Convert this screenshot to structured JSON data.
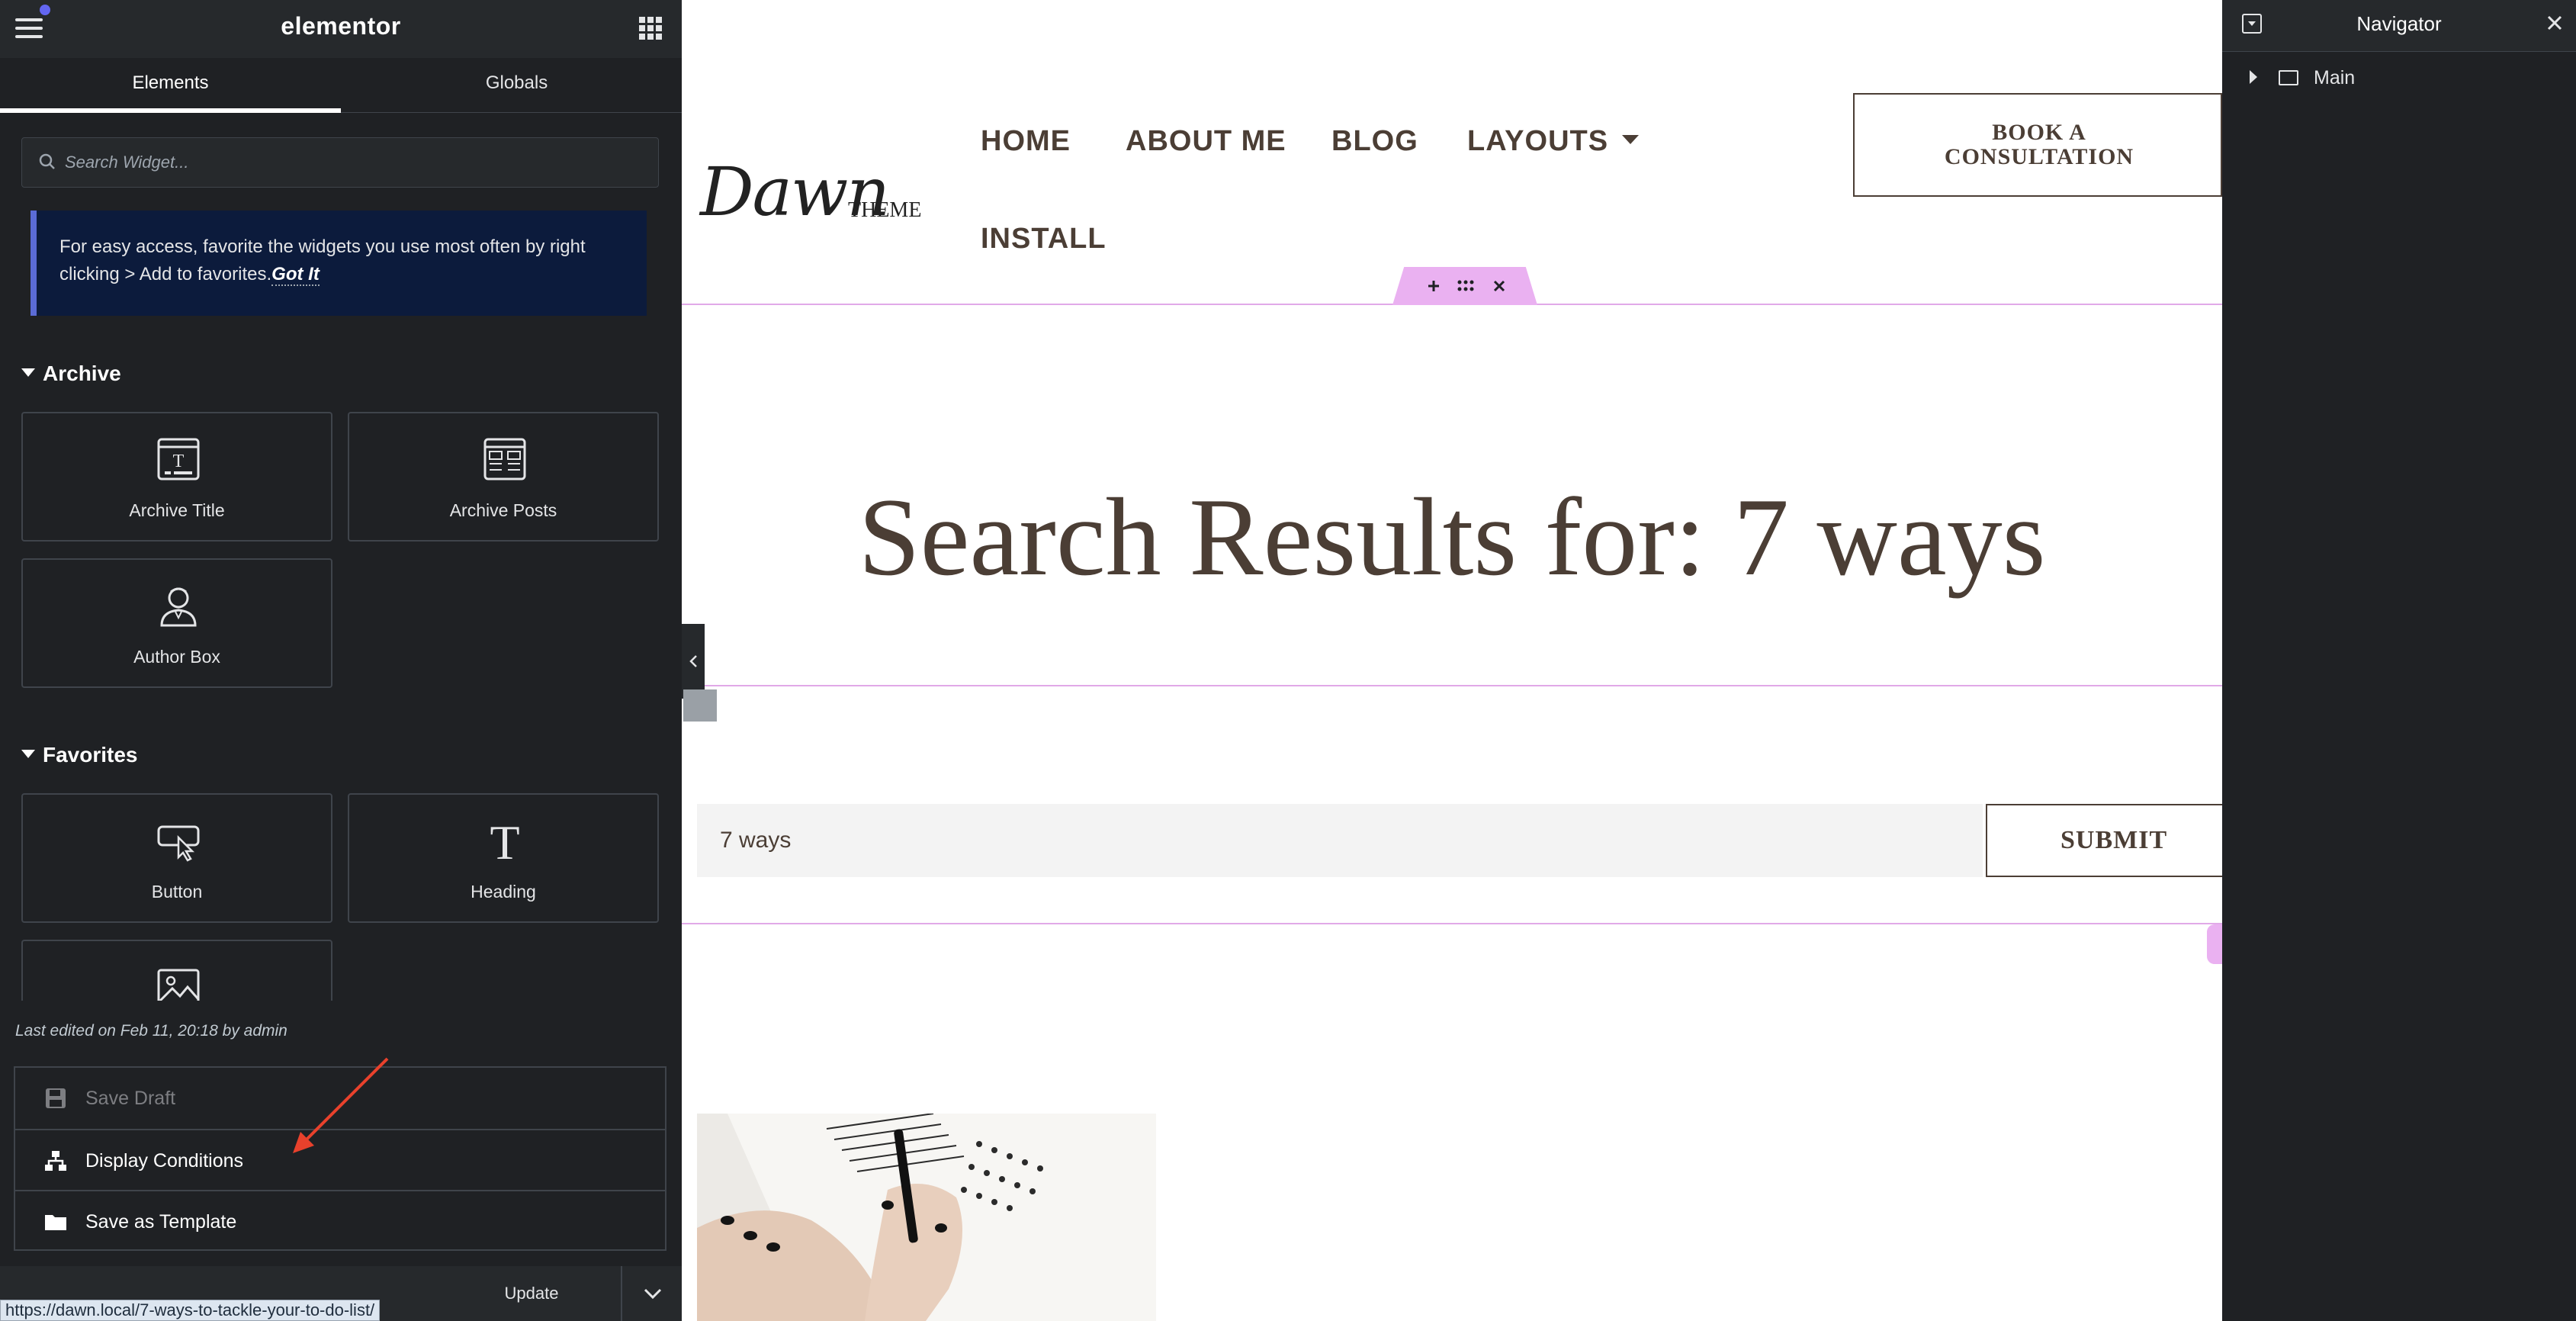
{
  "panel": {
    "logo": "elementor",
    "tabs": [
      {
        "label": "Elements",
        "active": true
      },
      {
        "label": "Globals",
        "active": false
      }
    ],
    "search": {
      "placeholder": "Search Widget..."
    },
    "notice": {
      "text": "For easy access, favorite the widgets you use most often by right clicking > Add to favorites.",
      "link": "Got It"
    },
    "sections": [
      {
        "title": "Archive",
        "widgets": [
          {
            "label": "Archive Title",
            "icon": "archive-title-icon"
          },
          {
            "label": "Archive Posts",
            "icon": "archive-posts-icon"
          },
          {
            "label": "Author Box",
            "icon": "author-box-icon"
          }
        ]
      },
      {
        "title": "Favorites",
        "widgets": [
          {
            "label": "Button",
            "icon": "button-icon"
          },
          {
            "label": "Heading",
            "icon": "heading-icon"
          },
          {
            "label": "",
            "icon": "image-icon"
          }
        ]
      }
    ],
    "last_edited": "Last edited on Feb 11, 20:18 by admin",
    "save_menu": [
      {
        "label": "Save Draft",
        "icon": "floppy-icon",
        "disabled": true
      },
      {
        "label": "Display Conditions",
        "icon": "sitemap-icon",
        "disabled": false
      },
      {
        "label": "Save as Template",
        "icon": "folder-icon",
        "disabled": false
      }
    ],
    "footer": {
      "update_label": "Update"
    }
  },
  "status_bar": {
    "url": "https://dawn.local/7-ways-to-tackle-your-to-do-list/"
  },
  "site": {
    "logo": "Dawn",
    "logo_sub": "THEME",
    "nav": [
      "HOME",
      "ABOUT ME",
      "BLOG",
      "LAYOUTS",
      "INSTALL"
    ],
    "cta": "BOOK A\nCONSULTATION",
    "heading": "Search Results for: 7 ways",
    "search_value": "7 ways",
    "submit_label": "SUBMIT"
  },
  "navigator": {
    "title": "Navigator",
    "items": [
      {
        "label": "Main"
      }
    ]
  },
  "colors": {
    "panel_bg": "#1f2124",
    "accent_pink": "#e1a9e8",
    "text_brown": "#4b3e35",
    "annotation_arrow": "#e8412c"
  }
}
